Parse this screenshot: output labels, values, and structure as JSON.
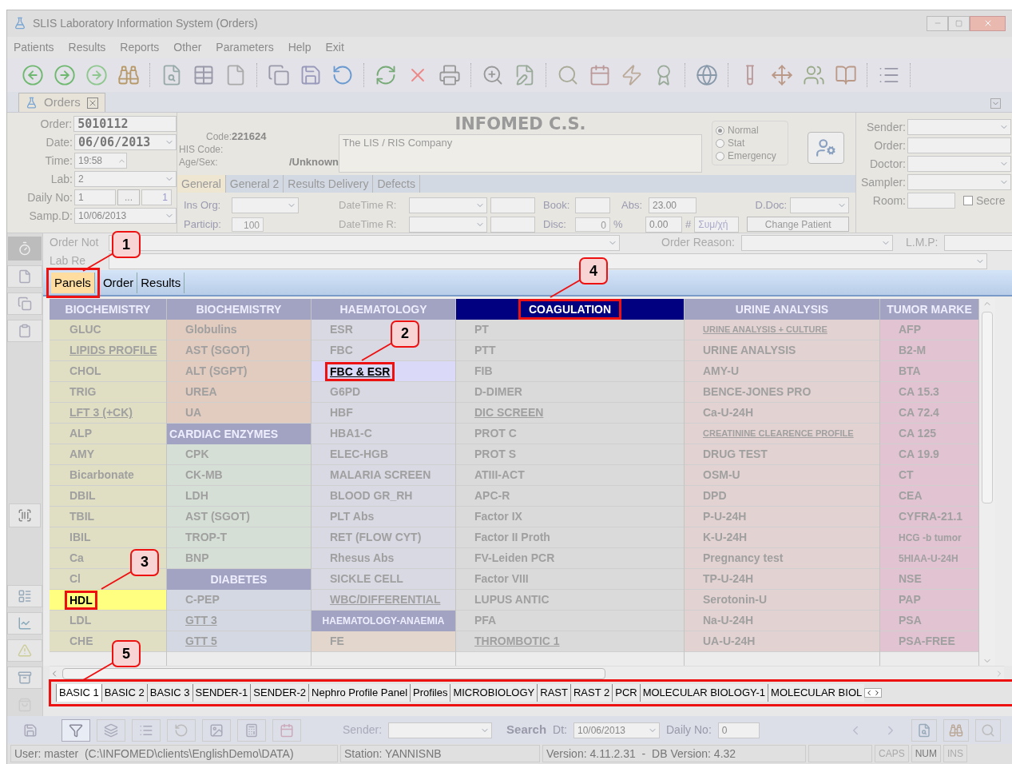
{
  "window": {
    "title": "SLIS Laboratory Information System (Orders)"
  },
  "menu": [
    "Patients",
    "Results",
    "Reports",
    "Other",
    "Parameters",
    "Help",
    "Exit"
  ],
  "document_tab": {
    "label": "Orders"
  },
  "order_fields": [
    {
      "label": "Order:",
      "value": "5010112",
      "kind": "text",
      "bold": true
    },
    {
      "label": "Date:",
      "value": "06/06/2013",
      "kind": "dropdown",
      "bold": true
    },
    {
      "label": "Time:",
      "value": "19:58",
      "kind": "spinner",
      "bold": false
    },
    {
      "label": "Lab:",
      "value": "2",
      "kind": "dropdown",
      "bold": false
    },
    {
      "label": "Daily No:",
      "value": "1",
      "kind": "counter",
      "bold": false,
      "button": "...",
      "count": "1"
    },
    {
      "label": "Samp.D:",
      "value": "10/06/2013",
      "kind": "dropdown",
      "bold": false
    }
  ],
  "patient": {
    "code_label": "Code:",
    "code": "221624",
    "his_label": "HIS Code:",
    "age_sex_label": "Age/Sex:",
    "age_sex": "/Unknown"
  },
  "company": {
    "name": "INFOMED C.S.",
    "tagline": "The LIS / RIS Company"
  },
  "priority": [
    {
      "label": "Normal",
      "selected": true
    },
    {
      "label": "Stat",
      "selected": false
    },
    {
      "label": "Emergency",
      "selected": false
    }
  ],
  "right_fields": [
    {
      "label": "Sender:",
      "kind": "dropdown"
    },
    {
      "label": "Order:",
      "kind": "text"
    },
    {
      "label": "Doctor:",
      "kind": "dropdown"
    },
    {
      "label": "Sampler:",
      "kind": "dropdown"
    },
    {
      "label": "Room:",
      "kind": "room",
      "checkbox": {
        "label": "Secre",
        "checked": false
      }
    }
  ],
  "sub_tabs": [
    {
      "label": "General",
      "selected": true
    },
    {
      "label": "General 2",
      "selected": false
    },
    {
      "label": "Results Delivery",
      "selected": false
    },
    {
      "label": "Defects",
      "selected": false
    }
  ],
  "general": {
    "ins_org": "Ins Org:",
    "particip_label": "Particip:",
    "particip": "100",
    "datetime_labels": [
      "DateTime R:",
      "DateTime R:"
    ],
    "book": "Book:",
    "disc": "Disc:",
    "disc_value": "0",
    "percent": "%",
    "abs": "Abs:",
    "abs_value": "23.00",
    "amount": "0.00",
    "hash": "#",
    "sum_placeholder": "Συμ/χή",
    "ddoc": "D.Doc:",
    "change_patient": "Change Patient"
  },
  "notes": {
    "order_notes": "Order Not",
    "lab_remarks": "Lab Re",
    "order_reason": "Order Reason:",
    "lmp": "L.M.P:"
  },
  "panel_tabs": [
    {
      "label": "Panels",
      "selected": true,
      "callout": "1"
    },
    {
      "label": "Order",
      "selected": false
    },
    {
      "label": "Results",
      "selected": false
    }
  ],
  "columns": [
    {
      "groups": [
        {
          "title": "BIOCHEMISTRY",
          "selected": false,
          "color": "#e0dfc3",
          "items": [
            {
              "label": "GLUC",
              "kind": "test",
              "selected": false
            },
            {
              "label": "LIPIDS PROFILE",
              "kind": "link",
              "selected": false
            },
            {
              "label": "CHOL",
              "kind": "test",
              "selected": false
            },
            {
              "label": "TRIG",
              "kind": "test",
              "selected": false
            },
            {
              "label": "LFT 3 (+CK)",
              "kind": "link",
              "selected": false
            },
            {
              "label": "ALP",
              "kind": "test",
              "selected": false
            },
            {
              "label": "AMY",
              "kind": "test",
              "selected": false
            },
            {
              "label": "Bicarbonate",
              "kind": "test",
              "selected": false
            },
            {
              "label": "DBIL",
              "kind": "test",
              "selected": false
            },
            {
              "label": "TBIL",
              "kind": "test",
              "selected": false
            },
            {
              "label": "IBIL",
              "kind": "test",
              "selected": false
            },
            {
              "label": "Ca",
              "kind": "test",
              "selected": false
            },
            {
              "label": "Cl",
              "kind": "test",
              "selected": false
            },
            {
              "label": "HDL",
              "kind": "test",
              "selected": true,
              "callout": "3"
            },
            {
              "label": "LDL",
              "kind": "test",
              "selected": false
            },
            {
              "label": "CHE",
              "kind": "test",
              "selected": false
            }
          ]
        }
      ]
    },
    {
      "groups": [
        {
          "title": "BIOCHEMISTRY",
          "selected": false,
          "color": "#e2cbbf",
          "items": [
            {
              "label": "Globulins",
              "kind": "test",
              "selected": false
            },
            {
              "label": "AST (SGOT)",
              "kind": "test",
              "selected": false
            },
            {
              "label": "ALT (SGPT)",
              "kind": "test",
              "selected": false
            },
            {
              "label": "UREA",
              "kind": "test",
              "selected": false
            },
            {
              "label": "UA",
              "kind": "test",
              "selected": false
            }
          ]
        },
        {
          "title": "CARDIAC ENZYMES",
          "selected": false,
          "color": "#d6dfd6",
          "items": [
            {
              "label": "CPK",
              "kind": "test",
              "selected": false
            },
            {
              "label": "CK-MB",
              "kind": "test",
              "selected": false
            },
            {
              "label": "LDH",
              "kind": "test",
              "selected": false
            },
            {
              "label": "AST (SGOT)",
              "kind": "test",
              "selected": false
            },
            {
              "label": "TROP-T",
              "kind": "test",
              "selected": false
            },
            {
              "label": "BNP",
              "kind": "test",
              "selected": false
            }
          ]
        },
        {
          "title": "DIABETES",
          "selected": false,
          "color": "#d3d8e2",
          "items": [
            {
              "label": "C-PEP",
              "kind": "test",
              "selected": false
            },
            {
              "label": "GTT 3",
              "kind": "link",
              "selected": false
            },
            {
              "label": "GTT 5",
              "kind": "link",
              "selected": false
            }
          ]
        }
      ]
    },
    {
      "groups": [
        {
          "title": "HAEMATOLOGY",
          "selected": false,
          "color": "#d9d9e3",
          "items": [
            {
              "label": "ESR",
              "kind": "test",
              "selected": false
            },
            {
              "label": "FBC",
              "kind": "test",
              "selected": false
            },
            {
              "label": "FBC & ESR",
              "kind": "link",
              "selected": true,
              "callout": "2"
            },
            {
              "label": "G6PD",
              "kind": "test",
              "selected": false
            },
            {
              "label": "HBF",
              "kind": "test",
              "selected": false
            },
            {
              "label": "HBA1-C",
              "kind": "test",
              "selected": false
            },
            {
              "label": "ELEC-HGB",
              "kind": "test",
              "selected": false
            },
            {
              "label": "MALARIA SCREEN",
              "kind": "test",
              "selected": false
            },
            {
              "label": "BLOOD GR_RH",
              "kind": "test",
              "selected": false
            },
            {
              "label": "PLT Abs",
              "kind": "test",
              "selected": false
            },
            {
              "label": "RET (FLOW CYT)",
              "kind": "test",
              "selected": false
            },
            {
              "label": "Rhesus Abs",
              "kind": "test",
              "selected": false
            },
            {
              "label": "SICKLE CELL",
              "kind": "test",
              "selected": false
            },
            {
              "label": "WBC/DIFFERENTIAL",
              "kind": "link",
              "selected": false
            }
          ]
        },
        {
          "title": "HAEMATOLOGY-ANAEMIA",
          "selected": false,
          "color": "#e3d6cd",
          "items": [
            {
              "label": "FE",
              "kind": "test",
              "selected": false
            }
          ]
        }
      ]
    },
    {
      "groups": [
        {
          "title": "COAGULATION",
          "selected": true,
          "callout": "4",
          "color": "#dadada",
          "items": [
            {
              "label": "PT",
              "kind": "test",
              "selected": false
            },
            {
              "label": "PTT",
              "kind": "test",
              "selected": false
            },
            {
              "label": "FIB",
              "kind": "test",
              "selected": false
            },
            {
              "label": "D-DIMER",
              "kind": "test",
              "selected": false
            },
            {
              "label": "DIC SCREEN",
              "kind": "link",
              "selected": false
            },
            {
              "label": "PROT C",
              "kind": "test",
              "selected": false
            },
            {
              "label": "PROT S",
              "kind": "test",
              "selected": false
            },
            {
              "label": "ATIII-ACT",
              "kind": "test",
              "selected": false
            },
            {
              "label": "APC-R",
              "kind": "test",
              "selected": false
            },
            {
              "label": "Factor IX",
              "kind": "test",
              "selected": false
            },
            {
              "label": "Factor II Proth",
              "kind": "test",
              "selected": false
            },
            {
              "label": "FV-Leiden PCR",
              "kind": "test",
              "selected": false
            },
            {
              "label": "Factor VIII",
              "kind": "test",
              "selected": false
            },
            {
              "label": "LUPUS ANTIC",
              "kind": "test",
              "selected": false
            },
            {
              "label": "PFA",
              "kind": "test",
              "selected": false
            },
            {
              "label": "THROMBOTIC 1",
              "kind": "link",
              "selected": false
            }
          ]
        }
      ]
    },
    {
      "groups": [
        {
          "title": "URINE ANALYSIS",
          "selected": false,
          "color": "#e3d2d2",
          "items": [
            {
              "label": "URINE ANALYSIS + CULTURE",
              "kind": "small-link",
              "selected": false
            },
            {
              "label": "URINE ANALYSIS",
              "kind": "test",
              "selected": false
            },
            {
              "label": "AMY-U",
              "kind": "test",
              "selected": false
            },
            {
              "label": "BENCE-JONES PRO",
              "kind": "test",
              "selected": false
            },
            {
              "label": "Ca-U-24H",
              "kind": "test",
              "selected": false
            },
            {
              "label": "CREATININE CLEARENCE PROFILE",
              "kind": "small-link",
              "selected": false
            },
            {
              "label": "DRUG TEST",
              "kind": "test",
              "selected": false
            },
            {
              "label": "OSM-U",
              "kind": "test",
              "selected": false
            },
            {
              "label": "DPD",
              "kind": "test",
              "selected": false
            },
            {
              "label": "P-U-24H",
              "kind": "test",
              "selected": false
            },
            {
              "label": "K-U-24H",
              "kind": "test",
              "selected": false
            },
            {
              "label": "Pregnancy test",
              "kind": "test",
              "selected": false
            },
            {
              "label": "TP-U-24H",
              "kind": "test",
              "selected": false
            },
            {
              "label": "Serotonin-U",
              "kind": "test",
              "selected": false
            },
            {
              "label": "Na-U-24H",
              "kind": "test",
              "selected": false
            },
            {
              "label": "UA-U-24H",
              "kind": "test",
              "selected": false
            }
          ]
        }
      ]
    },
    {
      "groups": [
        {
          "title": "TUMOR MARKE",
          "selected": false,
          "color": "#e2c3d2",
          "items": [
            {
              "label": "AFP",
              "kind": "test",
              "selected": false
            },
            {
              "label": "B2-M",
              "kind": "test",
              "selected": false
            },
            {
              "label": "BTA",
              "kind": "test",
              "selected": false
            },
            {
              "label": "CA 15.3",
              "kind": "test",
              "selected": false
            },
            {
              "label": "CA 72.4",
              "kind": "test",
              "selected": false
            },
            {
              "label": "CA 125",
              "kind": "test",
              "selected": false
            },
            {
              "label": "CA 19.9",
              "kind": "test",
              "selected": false
            },
            {
              "label": "CT",
              "kind": "test",
              "selected": false
            },
            {
              "label": "CEA",
              "kind": "test",
              "selected": false
            },
            {
              "label": "CYFRA-21.1",
              "kind": "test",
              "selected": false
            },
            {
              "label": "HCG -b tumor",
              "kind": "small",
              "selected": false
            },
            {
              "label": "5HIAA-U-24H",
              "kind": "small",
              "selected": false
            },
            {
              "label": "NSE",
              "kind": "test",
              "selected": false
            },
            {
              "label": "PAP",
              "kind": "test",
              "selected": false
            },
            {
              "label": "PSA",
              "kind": "test",
              "selected": false
            },
            {
              "label": "PSA-FREE",
              "kind": "test",
              "selected": false
            }
          ]
        }
      ]
    }
  ],
  "bottom_tabs": {
    "callout": "5",
    "tabs": [
      {
        "label": "BASIC 1",
        "selected": true
      },
      {
        "label": "BASIC 2",
        "selected": false
      },
      {
        "label": "BASIC 3",
        "selected": false
      },
      {
        "label": "SENDER-1",
        "selected": false
      },
      {
        "label": "SENDER-2",
        "selected": false
      },
      {
        "label": "Nephro Profile Panel",
        "selected": false
      },
      {
        "label": "Profiles",
        "selected": false
      },
      {
        "label": "MICROBIOLOGY",
        "selected": false
      },
      {
        "label": "RAST",
        "selected": false
      },
      {
        "label": "RAST 2",
        "selected": false
      },
      {
        "label": "PCR",
        "selected": false
      },
      {
        "label": "MOLECULAR BIOLOGY-1",
        "selected": false
      },
      {
        "label": "MOLECULAR BIOL",
        "selected": false
      }
    ]
  },
  "search_bar": {
    "sender": "Sender:",
    "search": "Search",
    "dt_label": "Dt:",
    "dt": "10/06/2013",
    "daily_label": "Daily No:",
    "daily": "0"
  },
  "status_bar": [
    {
      "text": "User: master  (C:\\INFOMED\\clients\\EnglishDemo\\DATA)",
      "disabled": false
    },
    {
      "text": "Station: YANNISNB",
      "disabled": false
    },
    {
      "text": "Version: 4.11.2.31  -  DB Version: 4.32",
      "disabled": false
    },
    {
      "text": "CAPS",
      "disabled": true
    },
    {
      "text": "NUM",
      "disabled": false
    },
    {
      "text": "INS",
      "disabled": true
    }
  ]
}
